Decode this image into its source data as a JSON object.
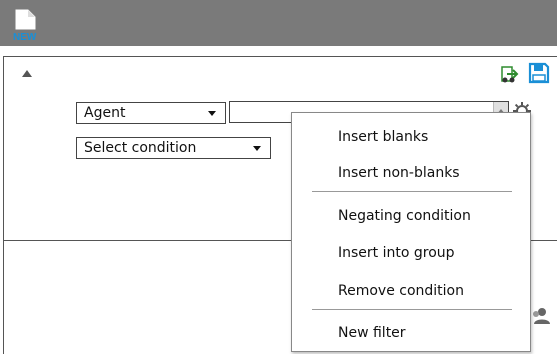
{
  "toolbar": {
    "new_icon_label": "NEW"
  },
  "filter": {
    "field_select": {
      "value": "Agent"
    },
    "condition_select": {
      "value": "Select condition"
    },
    "value_input": {
      "value": ""
    }
  },
  "context_menu": {
    "items": [
      {
        "label": "Insert blanks"
      },
      {
        "label": "Insert non-blanks"
      },
      {
        "label": "Negating condition"
      },
      {
        "label": "Insert into group"
      },
      {
        "label": "Remove condition"
      },
      {
        "label": "New filter"
      }
    ]
  },
  "colors": {
    "toolbar": "#7a7a7a",
    "accent_blue": "#1a8fd6",
    "export_green": "#2e8b2e"
  },
  "icons": [
    "new-document-icon",
    "collapse-arrow-icon",
    "export-icon",
    "save-icon",
    "gear-icon",
    "user-icon"
  ]
}
